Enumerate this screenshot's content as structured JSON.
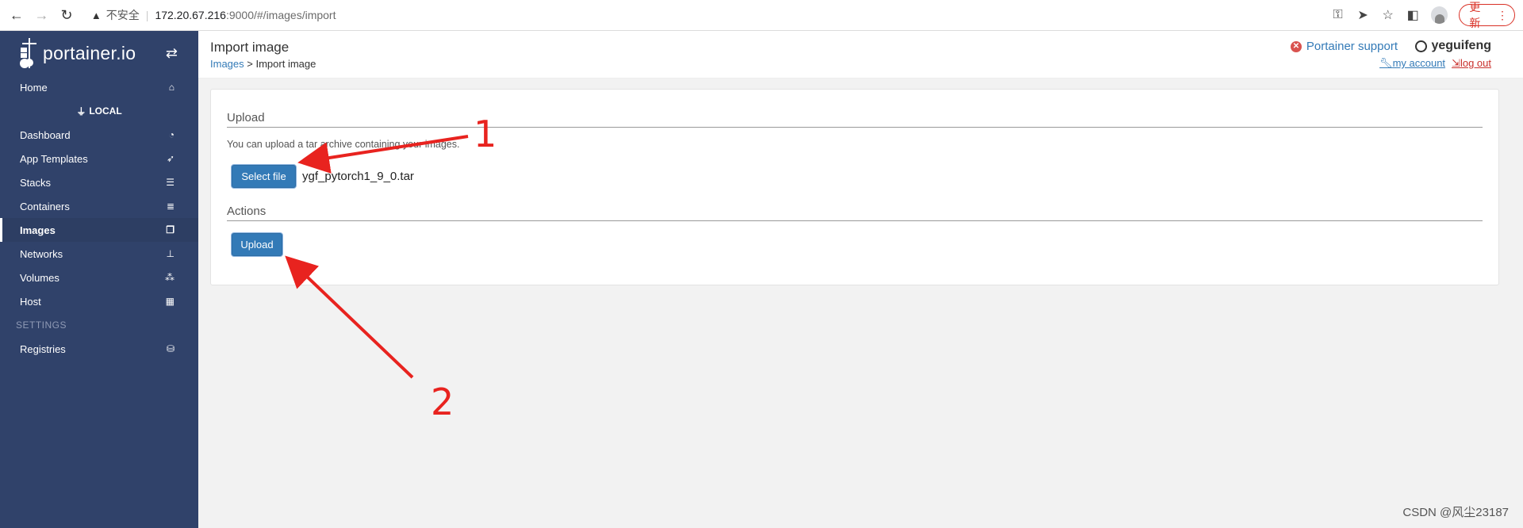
{
  "browser": {
    "insecure_label": "不安全",
    "url_host": "172.20.67.216",
    "url_path": ":9000/#/images/import",
    "update_label": "更新"
  },
  "sidebar": {
    "brand": "portainer.io",
    "home": "Home",
    "local_label": "LOCAL",
    "items": [
      {
        "label": "Dashboard",
        "icon": "dashboard-icon"
      },
      {
        "label": "App Templates",
        "icon": "rocket-icon"
      },
      {
        "label": "Stacks",
        "icon": "list-icon"
      },
      {
        "label": "Containers",
        "icon": "server-icon"
      },
      {
        "label": "Images",
        "icon": "clone-icon"
      },
      {
        "label": "Networks",
        "icon": "sitemap-icon"
      },
      {
        "label": "Volumes",
        "icon": "cubes-icon"
      },
      {
        "label": "Host",
        "icon": "grid-icon"
      }
    ],
    "settings_label": "SETTINGS",
    "registries": "Registries"
  },
  "header": {
    "title": "Import image",
    "breadcrumb_link": "Images",
    "breadcrumb_sep": ">",
    "breadcrumb_current": "Import image",
    "support": "Portainer support",
    "username": "yeguifeng",
    "my_account": "my account",
    "log_out": "log out"
  },
  "panel": {
    "upload_title": "Upload",
    "help_text": "You can upload a tar archive containing your images.",
    "select_file": "Select file",
    "file_name": "ygf_pytorch1_9_0.tar",
    "actions_title": "Actions",
    "upload_button": "Upload"
  },
  "annotations": {
    "one": "1",
    "two": "2",
    "color": "#e8231f"
  },
  "watermark": "CSDN @风尘23187"
}
